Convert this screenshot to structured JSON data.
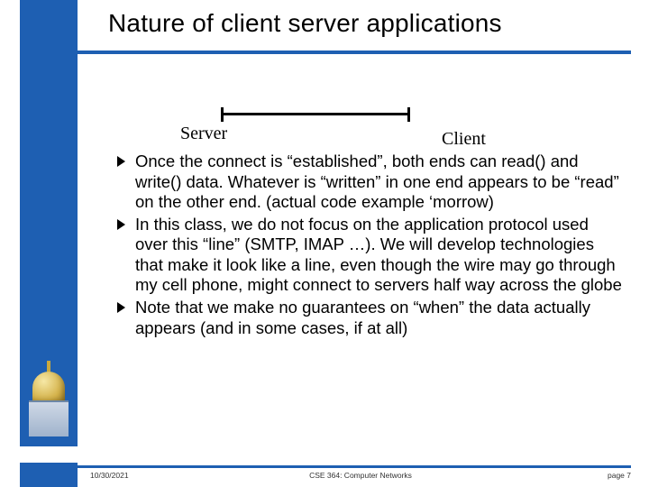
{
  "title": "Nature of client server applications",
  "diagram": {
    "server_label": "Server",
    "client_label": "Client"
  },
  "bullets": [
    "Once the connect is “established”, both ends can read() and write() data. Whatever is “written” in one end appears to be “read” on the other end. (actual code example ‘morrow)",
    "In this class, we do not focus on the application protocol used over this “line” (SMTP, IMAP …). We will develop technologies that make it look like a line, even though the wire may go through my cell phone, might connect to servers half way across the globe",
    "Note that we make no guarantees on “when” the data actually appears (and in some cases, if at all)"
  ],
  "footer": {
    "date": "10/30/2021",
    "course": "CSE 364: Computer Networks",
    "page": "page 7"
  },
  "colors": {
    "accent": "#1e5fb2"
  }
}
